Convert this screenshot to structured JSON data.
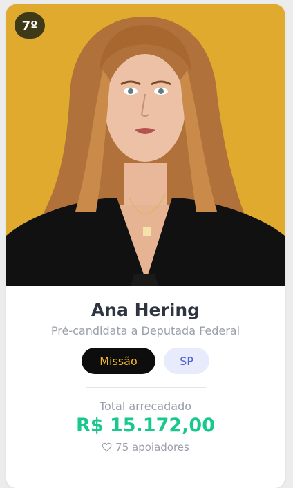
{
  "candidate": {
    "rank": "7º",
    "name": "Ana Hering",
    "role": "Pré-candidata a Deputada Federal",
    "photo_alt": "Retrato de Ana Hering"
  },
  "tags": {
    "mission": "Missão",
    "state": "SP"
  },
  "fundraising": {
    "total_label": "Total arrecadado",
    "total_value": "R$ 15.172,00",
    "supporters": "75 apoiadores"
  },
  "colors": {
    "photo_background": "#e0aa2f",
    "rank_badge": "#3e3a18",
    "mission_tag_bg": "#0d0d0d",
    "mission_tag_text": "#f2b530",
    "state_tag_bg": "#e8ebfb",
    "state_tag_text": "#4e5fd8",
    "total_value": "#18c88c"
  },
  "icons": {
    "supporters_icon": "heart-outline-icon"
  }
}
